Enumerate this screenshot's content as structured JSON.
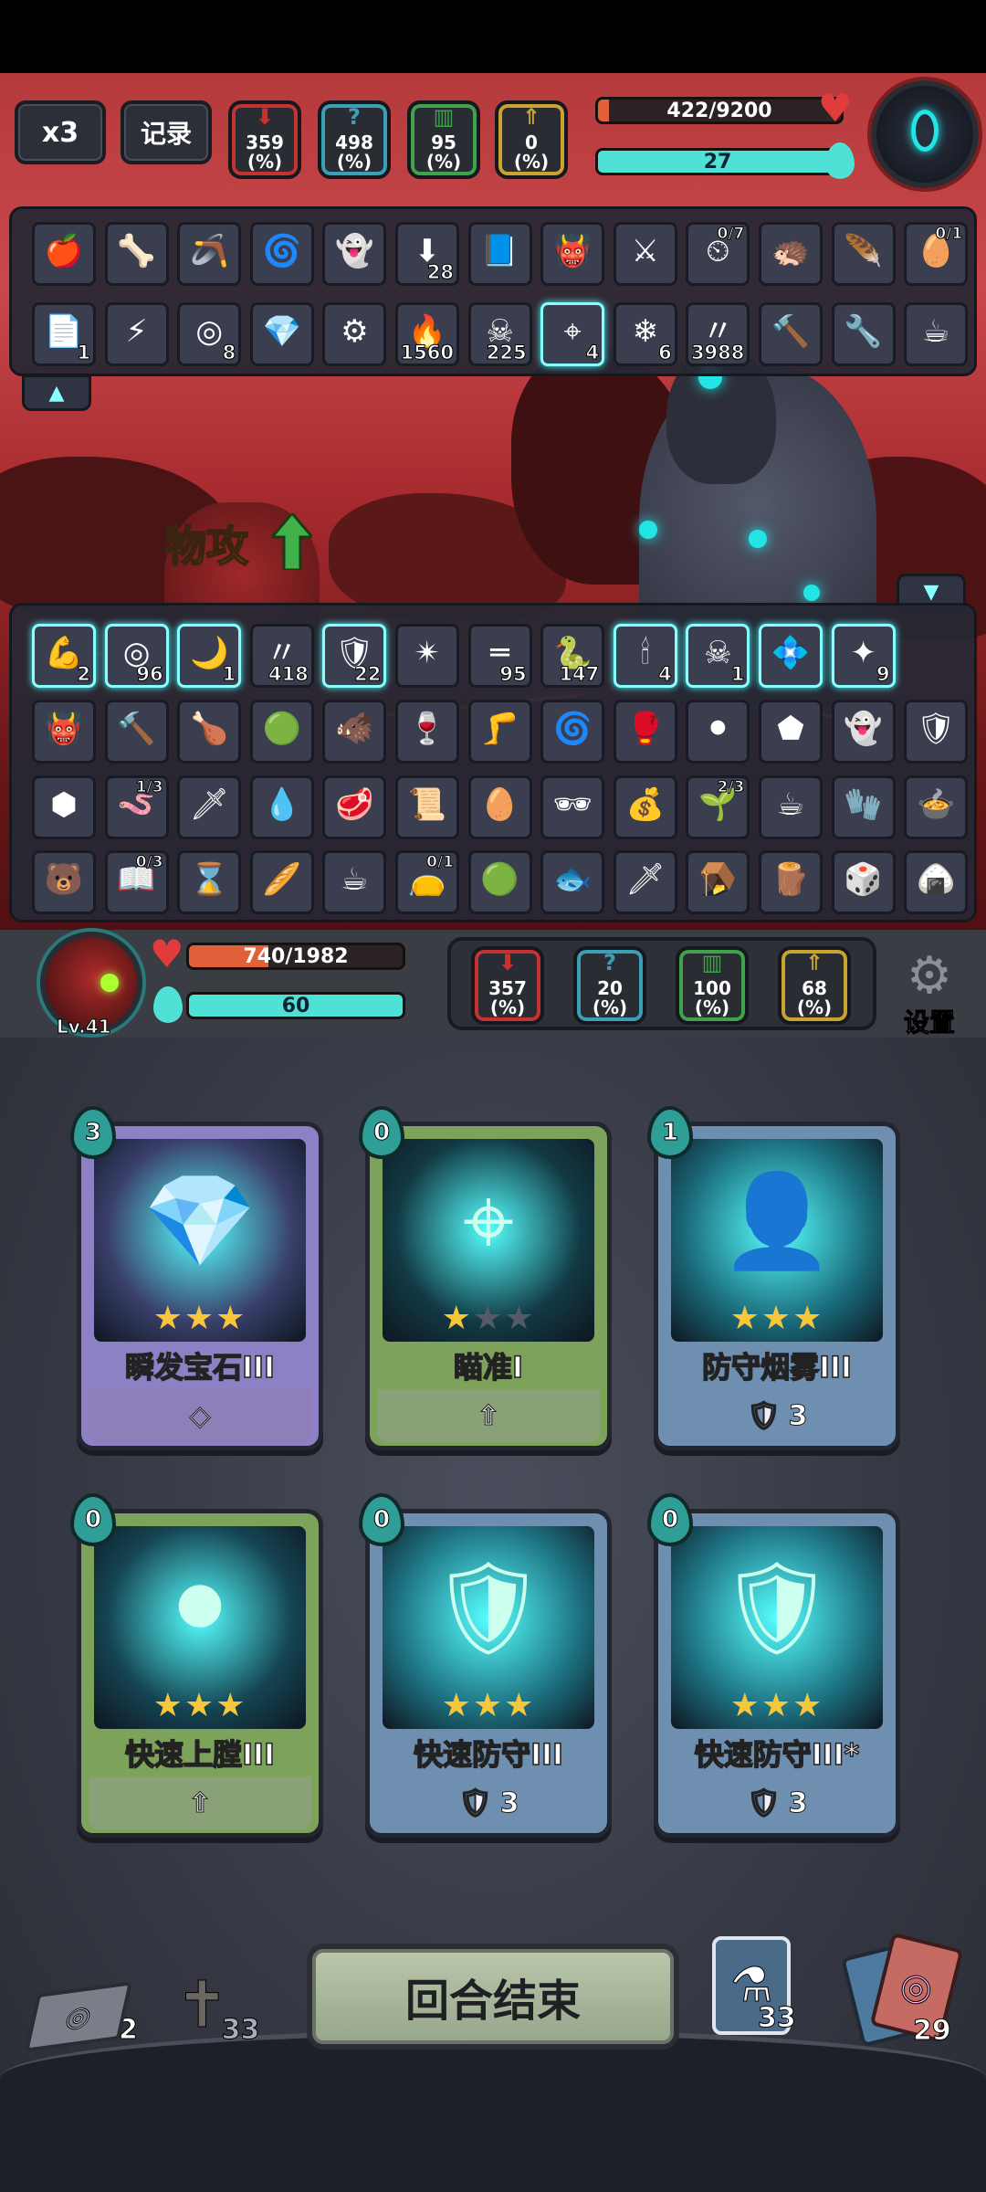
{
  "hud": {
    "speed_label": "x3",
    "log_label": "记录",
    "enemy_stats": [
      {
        "value": "359",
        "unit": "(%)",
        "color": "#c43232",
        "glyph": "⬇"
      },
      {
        "value": "498",
        "unit": "(%)",
        "color": "#3aa0b5",
        "glyph": "?"
      },
      {
        "value": "95",
        "unit": "(%)",
        "color": "#3fa34a",
        "glyph": "▥"
      },
      {
        "value": "0",
        "unit": "(%)",
        "color": "#c9a52e",
        "glyph": "⇑"
      }
    ],
    "enemy_hp": "422/9200",
    "enemy_hp_fraction": 0.046,
    "enemy_shield": "27",
    "enemy_shield_fraction": 1.0
  },
  "enemy_relics_row1": [
    {
      "icon": "🍎",
      "count": ""
    },
    {
      "icon": "🦴",
      "count": ""
    },
    {
      "icon": "🪃",
      "count": ""
    },
    {
      "icon": "🌀",
      "count": ""
    },
    {
      "icon": "👻",
      "count": ""
    },
    {
      "icon": "⬇",
      "count": "28"
    },
    {
      "icon": "📘",
      "count": ""
    },
    {
      "icon": "👹",
      "count": ""
    },
    {
      "icon": "⚔",
      "count": ""
    },
    {
      "icon": "⏲",
      "count": "0/7"
    },
    {
      "icon": "🦔",
      "count": ""
    },
    {
      "icon": "🪶",
      "count": ""
    },
    {
      "icon": "🥚",
      "count": "0/1"
    }
  ],
  "enemy_relics_row2": [
    {
      "icon": "📄",
      "count": "1"
    },
    {
      "icon": "⚡",
      "count": ""
    },
    {
      "icon": "◎",
      "count": "8"
    },
    {
      "icon": "💎",
      "count": ""
    },
    {
      "icon": "⚙",
      "count": ""
    },
    {
      "icon": "🔥",
      "count": "1560"
    },
    {
      "icon": "☠",
      "count": "225"
    },
    {
      "icon": "⌖",
      "count": "4"
    },
    {
      "icon": "❄",
      "count": "6"
    },
    {
      "icon": "〃",
      "count": "3988"
    },
    {
      "icon": "🔨",
      "count": ""
    },
    {
      "icon": "🔧",
      "count": ""
    },
    {
      "icon": "☕",
      "count": ""
    }
  ],
  "buff_text": "物攻",
  "player_buffs": [
    {
      "icon": "💪",
      "count": "2"
    },
    {
      "icon": "◎",
      "count": "96"
    },
    {
      "icon": "🌙",
      "count": "1"
    },
    {
      "icon": "〃",
      "count": "418"
    },
    {
      "icon": "🛡",
      "count": "22"
    },
    {
      "icon": "✴",
      "count": ""
    },
    {
      "icon": "═",
      "count": "95"
    },
    {
      "icon": "🐍",
      "count": "147"
    },
    {
      "icon": "🕯",
      "count": "4"
    },
    {
      "icon": "☠",
      "count": "1"
    },
    {
      "icon": "💠",
      "count": ""
    },
    {
      "icon": "✦",
      "count": "9"
    }
  ],
  "player_relics_row1": [
    {
      "icon": "👹",
      "count": ""
    },
    {
      "icon": "🔨",
      "count": ""
    },
    {
      "icon": "🍗",
      "count": ""
    },
    {
      "icon": "🟢",
      "count": ""
    },
    {
      "icon": "🐗",
      "count": ""
    },
    {
      "icon": "🍷",
      "count": ""
    },
    {
      "icon": "🦵",
      "count": ""
    },
    {
      "icon": "🌀",
      "count": ""
    },
    {
      "icon": "🥊",
      "count": ""
    },
    {
      "icon": "⚫",
      "count": ""
    },
    {
      "icon": "⬟",
      "count": ""
    },
    {
      "icon": "👻",
      "count": ""
    },
    {
      "icon": "🛡",
      "count": ""
    }
  ],
  "player_relics_row2": [
    {
      "icon": "⬢",
      "count": ""
    },
    {
      "icon": "🪱",
      "count": "1/3"
    },
    {
      "icon": "🗡",
      "count": ""
    },
    {
      "icon": "💧",
      "count": ""
    },
    {
      "icon": "🥩",
      "count": ""
    },
    {
      "icon": "📜",
      "count": ""
    },
    {
      "icon": "🥚",
      "count": ""
    },
    {
      "icon": "🕶",
      "count": ""
    },
    {
      "icon": "💰",
      "count": ""
    },
    {
      "icon": "🌱",
      "count": "2/3"
    },
    {
      "icon": "☕",
      "count": ""
    },
    {
      "icon": "🧤",
      "count": ""
    },
    {
      "icon": "🍲",
      "count": ""
    }
  ],
  "player_relics_row3": [
    {
      "icon": "🐻",
      "count": ""
    },
    {
      "icon": "📖",
      "count": "0/3"
    },
    {
      "icon": "⌛",
      "count": ""
    },
    {
      "icon": "🥖",
      "count": ""
    },
    {
      "icon": "☕",
      "count": ""
    },
    {
      "icon": "👝",
      "count": "0/1"
    },
    {
      "icon": "🟢",
      "count": ""
    },
    {
      "icon": "🐟",
      "count": ""
    },
    {
      "icon": "🗡",
      "count": ""
    },
    {
      "icon": "🪤",
      "count": ""
    },
    {
      "icon": "🪵",
      "count": ""
    },
    {
      "icon": "🎲",
      "count": ""
    },
    {
      "icon": "🍙",
      "count": ""
    }
  ],
  "player": {
    "level": "Lv.41",
    "hp": "740/1982",
    "hp_fraction": 0.373,
    "mana": "60",
    "mana_fraction": 1.0,
    "stats": [
      {
        "value": "357",
        "unit": "(%)",
        "color": "#c43232",
        "glyph": "⬇"
      },
      {
        "value": "20",
        "unit": "(%)",
        "color": "#3aa0b5",
        "glyph": "?"
      },
      {
        "value": "100",
        "unit": "(%)",
        "color": "#3fa34a",
        "glyph": "▥"
      },
      {
        "value": "68",
        "unit": "(%)",
        "color": "#c9a52e",
        "glyph": "⇑"
      }
    ],
    "settings_label": "设置"
  },
  "cards": [
    {
      "cost": "3",
      "name": "瞬发宝石III",
      "stars": 3,
      "band": "#8e80c4",
      "foot": "#8e7fb8",
      "foot_icon": "◇",
      "foot_value": "",
      "art": "#3a3f6a",
      "art_icon": "💎"
    },
    {
      "cost": "0",
      "name": "瞄准I",
      "stars": 1,
      "band": "#7da35a",
      "foot": "#8aa178",
      "foot_icon": "⇧",
      "foot_value": "",
      "art": "#123a44",
      "art_icon": "⌖"
    },
    {
      "cost": "1",
      "name": "防守烟雾III",
      "stars": 3,
      "band": "#6f8fb0",
      "foot": "#6f8fb0",
      "foot_icon": "🛡",
      "foot_value": "3",
      "art": "#1a6a7a",
      "art_icon": "👤"
    },
    {
      "cost": "0",
      "name": "快速上膛III",
      "stars": 3,
      "band": "#7da35a",
      "foot": "#8aa178",
      "foot_icon": "⇧",
      "foot_value": "",
      "art": "#154452",
      "art_icon": "⚫"
    },
    {
      "cost": "0",
      "name": "快速防守III",
      "stars": 3,
      "band": "#6f8fb0",
      "foot": "#6f8fb0",
      "foot_icon": "🛡",
      "foot_value": "3",
      "art": "#1d7080",
      "art_icon": "🛡"
    },
    {
      "cost": "0",
      "name": "快速防守III*",
      "stars": 3,
      "band": "#6f8fb0",
      "foot": "#6f8fb0",
      "foot_icon": "🛡",
      "foot_value": "3",
      "art": "#1d7080",
      "art_icon": "🛡"
    }
  ],
  "bottom_bar": {
    "draw_pile_count": "2",
    "grave_count": "33",
    "end_turn_label": "回合结束",
    "potion_count": "33",
    "discard_count": "29"
  }
}
